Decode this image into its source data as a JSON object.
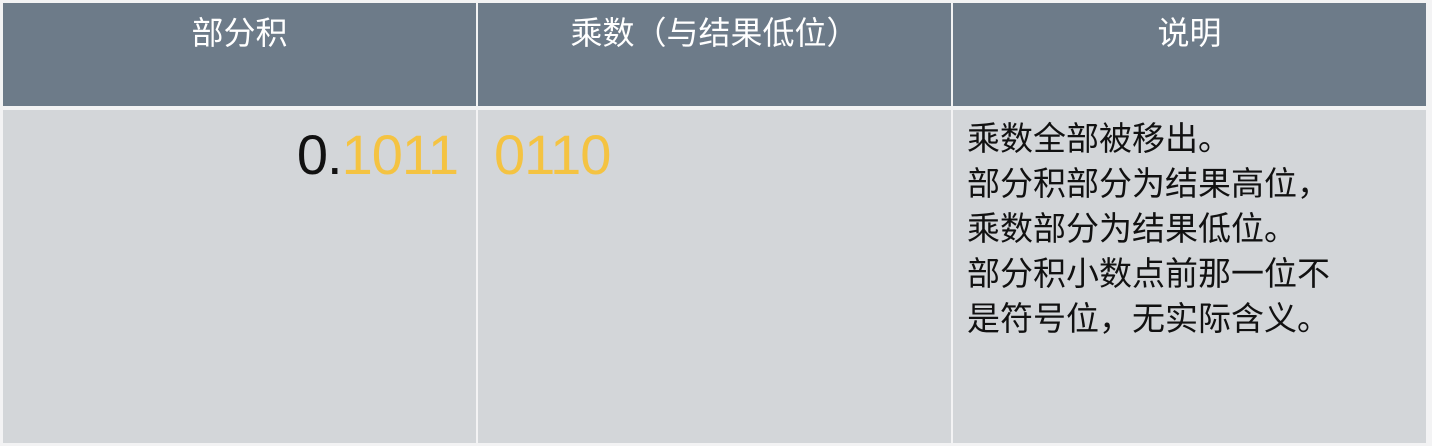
{
  "header": {
    "col1": "部分积",
    "col2": "乘数（与结果低位）",
    "col3": "说明"
  },
  "row": {
    "partial_product": {
      "prefix": "0.",
      "bits": "1011"
    },
    "multiplier": "0110",
    "notes": [
      "乘数全部被移出。",
      "部分积部分为结果高位，",
      "乘数部分为结果低位。",
      "部分积小数点前那一位不",
      "是符号位，无实际含义。"
    ]
  },
  "colors": {
    "header_bg": "#6d7b89",
    "cell_bg": "#d3d6d9",
    "highlight": "#f4c342",
    "text": "#111111"
  }
}
